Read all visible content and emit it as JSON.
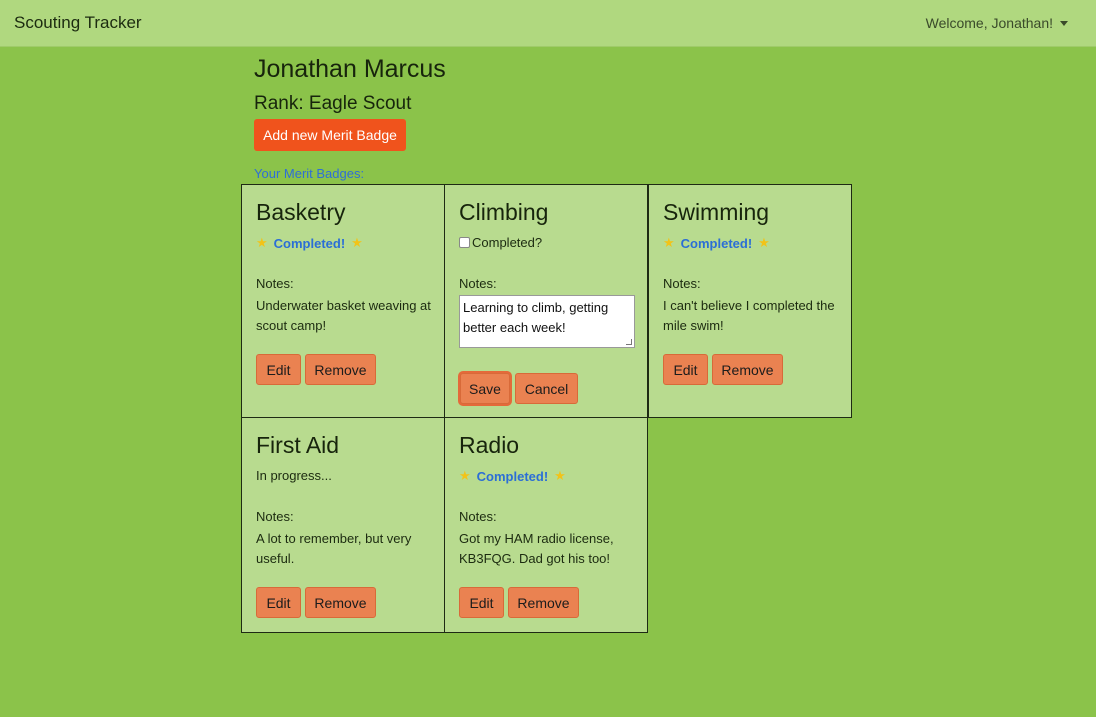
{
  "nav": {
    "brand": "Scouting Tracker",
    "welcome": "Welcome, Jonathan!"
  },
  "profile": {
    "name": "Jonathan Marcus",
    "rank": "Rank: Eagle Scout"
  },
  "actions": {
    "add_badge": "Add new Merit Badge"
  },
  "badges_label": "Your Merit Badges:",
  "labels": {
    "completed": "Completed!",
    "completed_question": "Completed?",
    "in_progress": "In progress...",
    "notes": "Notes:",
    "edit": "Edit",
    "remove": "Remove",
    "save": "Save",
    "cancel": "Cancel"
  },
  "badges": [
    {
      "title": "Basketry",
      "status": "completed",
      "notes": "Underwater basket weaving at scout camp!"
    },
    {
      "title": "Climbing",
      "status": "editing",
      "notes": "Learning to climb, getting better each week!"
    },
    {
      "title": "Swimming",
      "status": "completed",
      "notes": "I can't believe I completed the mile swim!"
    },
    {
      "title": "First Aid",
      "status": "in_progress",
      "notes": "A lot to remember, but very useful."
    },
    {
      "title": "Radio",
      "status": "completed",
      "notes": "Got my HAM radio license, KB3FQG. Dad got his too!"
    }
  ]
}
